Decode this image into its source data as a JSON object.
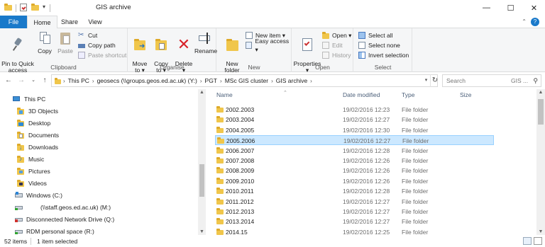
{
  "window": {
    "title": "GIS archive",
    "controls": [
      "minimize",
      "maximize",
      "close"
    ]
  },
  "ribbon": {
    "tabs": [
      "File",
      "Home",
      "Share",
      "View"
    ],
    "active_tab": "Home",
    "groups": {
      "clipboard": {
        "label": "Clipboard",
        "pin": "Pin to Quick\naccess",
        "copy": "Copy",
        "paste": "Paste",
        "cut": "Cut",
        "copy_path": "Copy path",
        "paste_shortcut": "Paste shortcut"
      },
      "organise": {
        "label": "Organise",
        "move_to": "Move\nto ▾",
        "copy_to": "Copy\nto ▾",
        "delete": "Delete\n▾",
        "rename": "Rename"
      },
      "new": {
        "label": "New",
        "new_folder": "New\nfolder",
        "new_item": "New item ▾",
        "easy_access": "Easy access ▾"
      },
      "open": {
        "label": "Open",
        "properties": "Properties\n▾",
        "open": "Open ▾",
        "edit": "Edit",
        "history": "History"
      },
      "select": {
        "label": "Select",
        "select_all": "Select all",
        "select_none": "Select none",
        "invert_selection": "Invert selection"
      }
    }
  },
  "address": {
    "crumbs": [
      "This PC",
      "geosecs (\\\\groups.geos.ed.ac.uk) (Y:)",
      "PGT",
      "MSc GIS cluster",
      "GIS archive"
    ],
    "search_placeholder": "Search",
    "search_placeholder_tail": "GIS ..."
  },
  "nav": {
    "items": [
      {
        "label": "This PC",
        "icon": "pc-icon"
      },
      {
        "label": "3D Objects",
        "icon": "3d-objects-icon"
      },
      {
        "label": "Desktop",
        "icon": "desktop-icon"
      },
      {
        "label": "Documents",
        "icon": "documents-icon"
      },
      {
        "label": "Downloads",
        "icon": "downloads-icon"
      },
      {
        "label": "Music",
        "icon": "music-icon"
      },
      {
        "label": "Pictures",
        "icon": "pictures-icon"
      },
      {
        "label": "Videos",
        "icon": "videos-icon"
      },
      {
        "label": "Windows (C:)",
        "icon": "drive-icon"
      },
      {
        "label": "(\\\\staff.geos.ed.ac.uk) (M:)",
        "icon": "network-drive-icon"
      },
      {
        "label": "Disconnected Network Drive (Q:)",
        "icon": "disconnected-drive-icon"
      },
      {
        "label": "RDM personal space (R:)",
        "icon": "network-drive-icon"
      }
    ]
  },
  "list": {
    "columns": [
      "Name",
      "Date modified",
      "Type",
      "Size"
    ],
    "rows": [
      {
        "name": "2002.2003",
        "date": "19/02/2016 12:23",
        "type": "File folder"
      },
      {
        "name": "2003.2004",
        "date": "19/02/2016 12:27",
        "type": "File folder"
      },
      {
        "name": "2004.2005",
        "date": "19/02/2016 12:30",
        "type": "File folder"
      },
      {
        "name": "2005.2006",
        "date": "19/02/2016 12:27",
        "type": "File folder"
      },
      {
        "name": "2006.2007",
        "date": "19/02/2016 12:28",
        "type": "File folder"
      },
      {
        "name": "2007.2008",
        "date": "19/02/2016 12:26",
        "type": "File folder"
      },
      {
        "name": "2008.2009",
        "date": "19/02/2016 12:26",
        "type": "File folder"
      },
      {
        "name": "2009.2010",
        "date": "19/02/2016 12:26",
        "type": "File folder"
      },
      {
        "name": "2010.2011",
        "date": "19/02/2016 12:28",
        "type": "File folder"
      },
      {
        "name": "2011.2012",
        "date": "19/02/2016 12:27",
        "type": "File folder"
      },
      {
        "name": "2012.2013",
        "date": "19/02/2016 12:27",
        "type": "File folder"
      },
      {
        "name": "2013.2014",
        "date": "19/02/2016 12:27",
        "type": "File folder"
      },
      {
        "name": "2014.15",
        "date": "19/02/2016 12:25",
        "type": "File folder"
      }
    ],
    "selected_row": "2005.2006"
  },
  "status": {
    "item_count": "52 items",
    "selection": "1 item selected"
  },
  "colors": {
    "accent": "#1979ca",
    "folder": "#f0c64b",
    "selection_bg": "#cce8ff",
    "selection_border": "#99d1ff"
  }
}
